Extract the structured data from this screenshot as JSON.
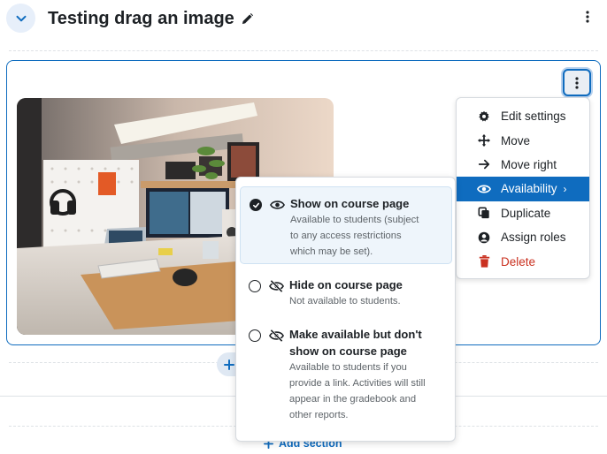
{
  "section": {
    "title": "Testing drag an image"
  },
  "action_menu": {
    "items": [
      {
        "label": "Edit settings",
        "icon": "gear-icon"
      },
      {
        "label": "Move",
        "icon": "move-arrows-icon"
      },
      {
        "label": "Move right",
        "icon": "arrow-right-icon"
      },
      {
        "label": "Availability",
        "icon": "eye-icon",
        "chevron": "›"
      },
      {
        "label": "Duplicate",
        "icon": "duplicate-icon"
      },
      {
        "label": "Assign roles",
        "icon": "user-icon"
      },
      {
        "label": "Delete",
        "icon": "trash-icon"
      }
    ],
    "active_color": "#0f6cbf",
    "danger_color": "#ca3120"
  },
  "availability": {
    "options": [
      {
        "title": "Show on course page",
        "desc": [
          "Available to students (subject",
          "to any access restrictions",
          "which may be set)."
        ],
        "selected": true
      },
      {
        "title": "Hide on course page",
        "desc": [
          "Not available to students."
        ],
        "selected": false
      },
      {
        "title_lines": [
          "Make available but don't",
          "show on course page"
        ],
        "desc": [
          "Available to students if you",
          "provide a link. Activities will still",
          "appear in the gradebook and",
          "other reports."
        ],
        "selected": false
      }
    ]
  },
  "footer": {
    "add_section_label": "Add section",
    "add_icon": "plus-icon"
  },
  "colors": {
    "brand": "#0f6cbf",
    "text": "#1d2125",
    "muted": "#5e6469"
  }
}
